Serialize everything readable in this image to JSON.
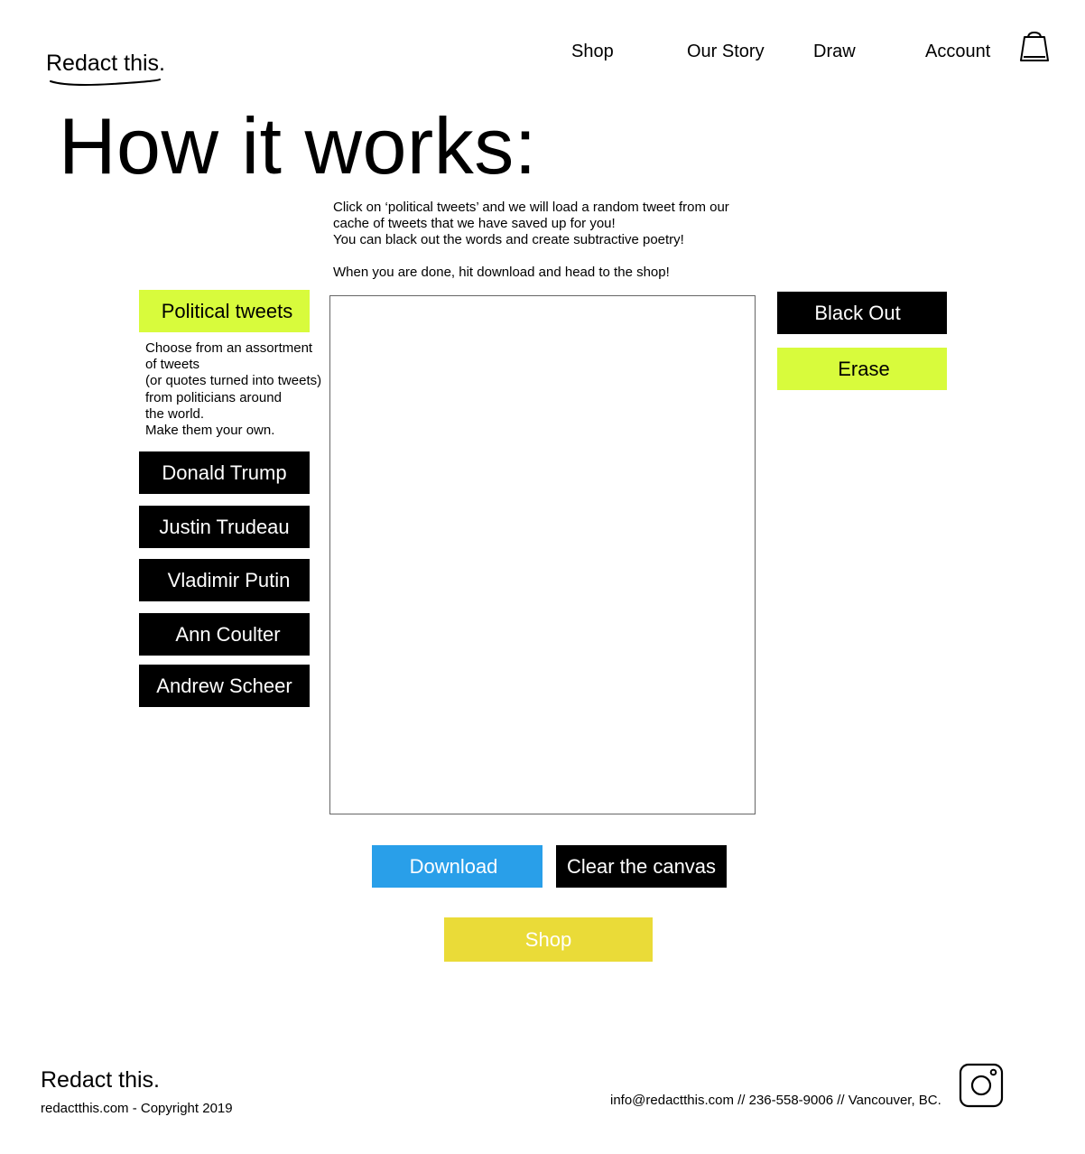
{
  "header": {
    "logo": "Redact this.",
    "nav": [
      "Shop",
      "Our Story",
      "Draw",
      "Account"
    ],
    "cart_icon": "shopping-bag-icon"
  },
  "hero": {
    "title": "How it works:"
  },
  "intro": {
    "line1": "Click on ‘political tweets’ and we will load a random tweet from our cache of tweets that we have saved up for you!",
    "line2": "You can black out the words and create subtractive poetry!",
    "line3": "When you are done, hit download and head to the shop!"
  },
  "sidebar": {
    "category_button": "Political tweets",
    "description": [
      "Choose from an assortment",
      "of tweets",
      "(or quotes turned into tweets)",
      "from politicians around",
      "the world.",
      "Make them your own."
    ],
    "politicians": [
      "Donald Trump",
      "Justin Trudeau",
      "Vladimir Putin",
      "Ann Coulter",
      "Andrew Scheer"
    ]
  },
  "tools": {
    "black_out": "Black Out",
    "erase": "Erase"
  },
  "actions": {
    "download": "Download",
    "clear": "Clear the canvas",
    "shop": "Shop"
  },
  "footer": {
    "logo": "Redact this.",
    "copyright": "redactthis.com - Copyright 2019",
    "contact": "info@redactthis.com // 236-558-9006 // Vancouver, BC.",
    "social_icon": "instagram-icon"
  },
  "colors": {
    "lime": "#d8fb3c",
    "blue": "#299fe9",
    "yellow": "#eadb38",
    "black": "#000000"
  }
}
